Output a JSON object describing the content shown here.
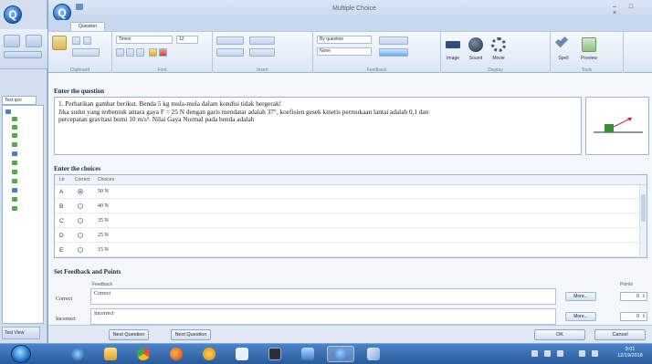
{
  "window": {
    "title": "Multiple Choice",
    "tab": "Question",
    "controls": "– □ ×"
  },
  "background_app": {
    "tree_tab": "Test qsn",
    "status": "Test View"
  },
  "ribbon": {
    "groups": [
      {
        "label": "Clipboard"
      },
      {
        "label": "Font"
      },
      {
        "label": "Insert"
      },
      {
        "label": "Feedback"
      },
      {
        "label": "Display"
      },
      {
        "label": "Tools"
      }
    ],
    "font_name": "Times",
    "font_size": "12",
    "feedback_value": "By question",
    "shuffle_value": "None",
    "icon_labels": [
      "Image",
      "Sound",
      "Movie",
      "Spell",
      "Preview"
    ]
  },
  "question": {
    "section_title": "Enter the question",
    "lines": [
      "1. Perhatikan gambar berikut. Benda 5 kg mula-mula dalam kondisi tidak bergerak!",
      "Jika sudut yang terbentuk antara gaya F = 25 N dengan garis mendatar adalah 37°, koefisien gesek kinetis permukaan lantai adalah 0,1 dan",
      "percepatan gravitasi bumi 10 m/s². Nilai Gaya Normal pada benda adalah"
    ]
  },
  "choices": {
    "section_title": "Enter the choices",
    "headers": [
      "Ltr",
      "Correct",
      "Choices"
    ],
    "rows": [
      {
        "letter": "A",
        "correct": true,
        "value": "50 N"
      },
      {
        "letter": "B",
        "correct": false,
        "value": "40 N"
      },
      {
        "letter": "C",
        "correct": false,
        "value": "35 N"
      },
      {
        "letter": "D",
        "correct": false,
        "value": "25 N"
      },
      {
        "letter": "E",
        "correct": false,
        "value": "15 N"
      }
    ]
  },
  "feedback": {
    "section_title": "Set Feedback and Points",
    "col_feedback": "Feedback",
    "col_points": "Points",
    "rows": [
      {
        "label": "Correct",
        "text": "Correct",
        "more": "More...",
        "points": "0"
      },
      {
        "label": "Incorrect",
        "text": "Incorrect",
        "more": "More...",
        "points": "0"
      }
    ]
  },
  "footer": {
    "prev": "Next Question",
    "next": "Next Question",
    "ok": "OK",
    "cancel": "Cancel"
  },
  "taskbar": {
    "time": "9:01",
    "date": "12/19/2018"
  },
  "colors": {
    "accent": "#2b5797",
    "taskbar": "#2a5b9c",
    "frame": "#dfe8f3"
  }
}
